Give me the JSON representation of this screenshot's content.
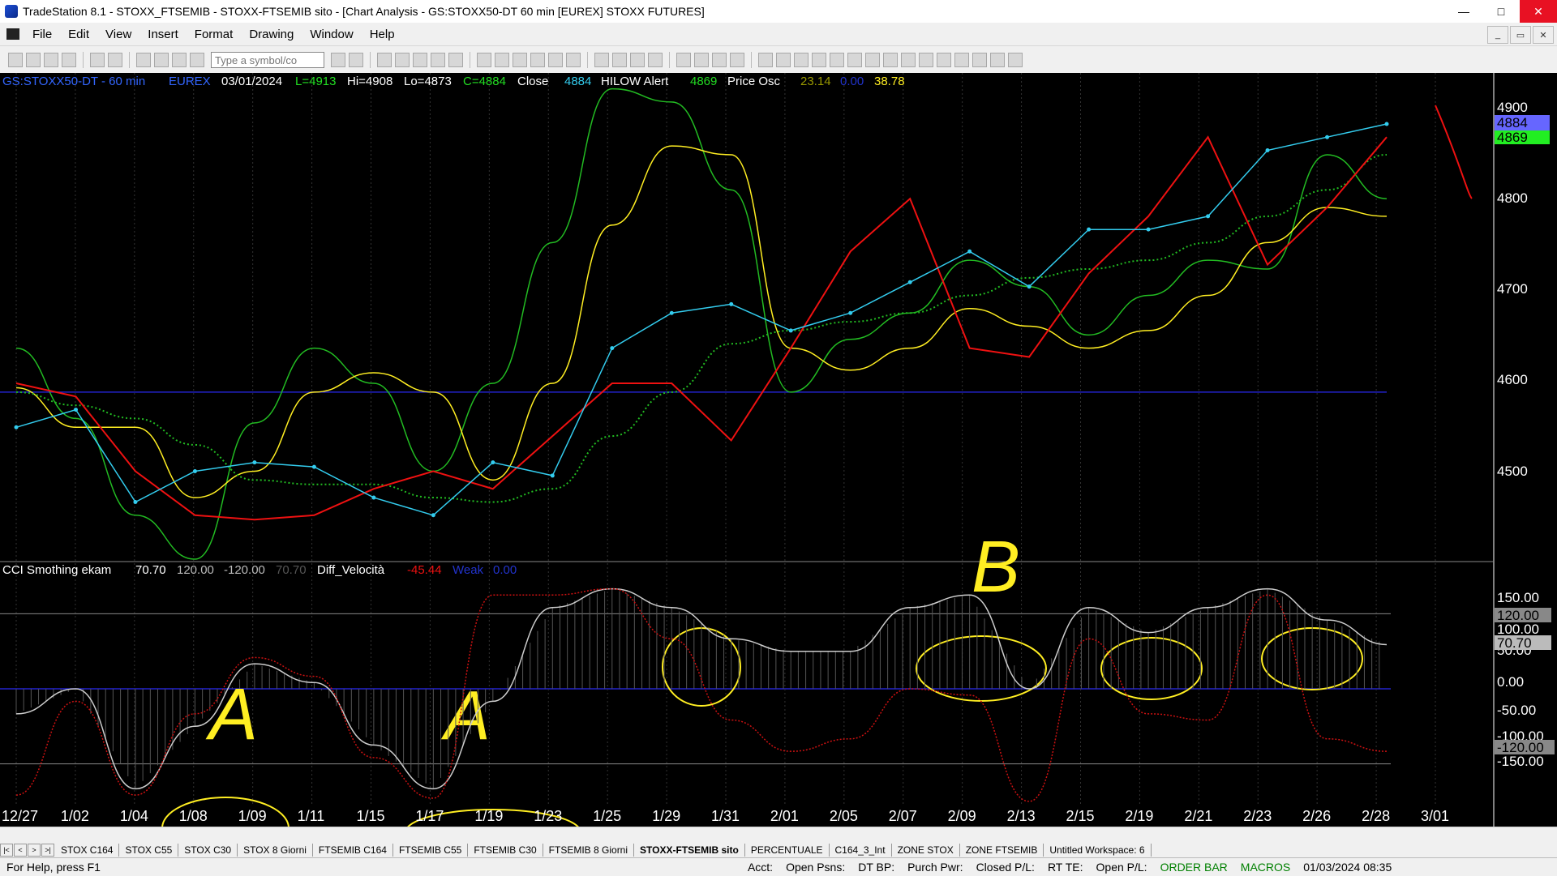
{
  "window": {
    "title": "TradeStation 8.1 - STOXX_FTSEMIB - STOXX-FTSEMIB sito - [Chart Analysis - GS:STOXX50-DT  60 min  [EUREX] STOXX FUTURES]"
  },
  "menu": [
    "File",
    "Edit",
    "View",
    "Insert",
    "Format",
    "Drawing",
    "Window",
    "Help"
  ],
  "toolbar": {
    "symbol_placeholder": "Type a symbol/co"
  },
  "price_header": {
    "symbol": "GS:STOXX50-DT - 60 min",
    "exchange": "EUREX",
    "date": "03/01/2024",
    "last": "L=4913",
    "high": "Hi=4908",
    "low": "Lo=4873",
    "close": "C=4884",
    "close_label": "Close",
    "close_value": "4884",
    "hilow_label": "HILOW Alert",
    "hilow_value": "4869",
    "osc_label": "Price Osc",
    "osc_v1": "23.14",
    "osc_v2": "0.00",
    "osc_v3": "38.78"
  },
  "cci_header": {
    "name": "CCI Smothing ekam",
    "v1": "70.70",
    "v2": "120.00",
    "v3": "-120.00",
    "v4": "70.70",
    "diff_name": "Diff_Velocità",
    "diff_value": "-45.44",
    "weak_label": "Weak",
    "weak_value": "0.00"
  },
  "price_axis": {
    "ticks": [
      "4900",
      "4800",
      "4700",
      "4600",
      "4500"
    ],
    "last_tag": "4884",
    "hilow_tag": "4869"
  },
  "cci_axis": {
    "ticks": [
      "150.00",
      "100.00",
      "50.00",
      "0.00",
      "-50.00",
      "-100.00",
      "-150.00"
    ],
    "tag_120": "120.00",
    "tag_cci": "70.70",
    "tag_m120": "-120.00"
  },
  "time_axis": [
    "12/27",
    "1/02",
    "1/04",
    "1/08",
    "1/09",
    "1/11",
    "1/15",
    "1/17",
    "1/19",
    "1/23",
    "1/25",
    "1/29",
    "1/31",
    "2/01",
    "2/05",
    "2/07",
    "2/09",
    "2/13",
    "2/15",
    "2/19",
    "2/21",
    "2/23",
    "2/26",
    "2/28",
    "3/01"
  ],
  "annotations": {
    "letter_a1": "A",
    "letter_a2": "A",
    "letter_b": "B"
  },
  "tabs": [
    "STOX C164",
    "STOX C55",
    "STOX  C30",
    "STOX  8 Giorni",
    "FTSEMIB C164",
    "FTSEMIB C55",
    "FTSEMIB C30",
    "FTSEMIB  8 Giorni",
    "STOXX-FTSEMIB sito",
    "PERCENTUALE",
    "C164_3_Int",
    "ZONE STOX",
    "ZONE FTSEMIB",
    "Untitled Workspace:  6"
  ],
  "active_tab": "STOXX-FTSEMIB sito",
  "status": {
    "help": "For Help, press F1",
    "acct": "Acct:",
    "open_psns": "Open Psns:",
    "dt_bp": "DT BP:",
    "purch_pwr": "Purch Pwr:",
    "closed_pl": "Closed P/L:",
    "rt_te": "RT TE:",
    "open_pl": "Open P/L:",
    "order_bar": "ORDER BAR",
    "macros": "MACROS",
    "datetime": "01/03/2024 08:35"
  },
  "colors": {
    "price": "#33ccee",
    "green": "#22bb22",
    "yellow": "#ffee22",
    "red": "#ee1111",
    "darkred": "#cc1111",
    "blue": "#2222cc",
    "grid": "#444"
  },
  "chart_data": [
    {
      "type": "line",
      "title": "GS:STOXX50-DT - 60 min",
      "ylim": [
        4400,
        4930
      ],
      "x": [
        "12/27",
        "1/02",
        "1/04",
        "1/08",
        "1/09",
        "1/11",
        "1/15",
        "1/17",
        "1/19",
        "1/23",
        "1/25",
        "1/29",
        "1/31",
        "2/01",
        "2/05",
        "2/07",
        "2/09",
        "2/13",
        "2/15",
        "2/19",
        "2/21",
        "2/23",
        "2/26",
        "2/28"
      ],
      "series": [
        {
          "name": "Close",
          "values": [
            4550,
            4570,
            4465,
            4500,
            4510,
            4505,
            4470,
            4450,
            4510,
            4495,
            4640,
            4680,
            4690,
            4660,
            4680,
            4715,
            4750,
            4710,
            4775,
            4775,
            4790,
            4865,
            4880,
            4895
          ]
        },
        {
          "values": [
            4640,
            4560,
            4450,
            4400,
            4555,
            4640,
            4600,
            4500,
            4600,
            4760,
            4935,
            4920,
            4820,
            4590,
            4650,
            4680,
            4740,
            4710,
            4655,
            4700,
            4740,
            4730,
            4860,
            4810
          ]
        },
        {
          "values": [
            4595,
            4550,
            4550,
            4470,
            4500,
            4590,
            4612,
            4590,
            4490,
            4600,
            4780,
            4870,
            4860,
            4640,
            4615,
            4640,
            4685,
            4665,
            4640,
            4660,
            4700,
            4760,
            4800,
            4790
          ]
        },
        {
          "values": [
            4590,
            4575,
            4560,
            4530,
            4490,
            4485,
            4485,
            4470,
            4465,
            4480,
            4540,
            4590,
            4645,
            4660,
            4670,
            4680,
            4700,
            4720,
            4730,
            4740,
            4760,
            4790,
            4820,
            4860
          ]
        },
        {
          "values": [
            4600,
            4585,
            4500,
            4450,
            4445,
            4450,
            4480,
            4500,
            4480,
            4540,
            4600,
            4600,
            4535,
            4640,
            4750,
            4810,
            4640,
            4630,
            4725,
            4790,
            4880,
            4735,
            4800,
            4880
          ]
        }
      ]
    },
    {
      "type": "area",
      "title": "CCI Smothing ekam",
      "ylim": [
        -175,
        175
      ],
      "x": [
        "12/27",
        "1/02",
        "1/04",
        "1/08",
        "1/09",
        "1/11",
        "1/15",
        "1/17",
        "1/19",
        "1/23",
        "1/25",
        "1/29",
        "1/31",
        "2/01",
        "2/05",
        "2/07",
        "2/09",
        "2/13",
        "2/15",
        "2/19",
        "2/21",
        "2/23",
        "2/26",
        "2/28"
      ],
      "series": [
        {
          "name": "CCI Smothing ekam",
          "values": [
            -40,
            0,
            -160,
            -60,
            40,
            10,
            -90,
            -160,
            -20,
            130,
            160,
            130,
            80,
            60,
            60,
            130,
            150,
            0,
            130,
            90,
            130,
            160,
            110,
            70.7
          ]
        },
        {
          "name": "Diff_Velocità",
          "values": [
            -170,
            -20,
            -170,
            -40,
            50,
            20,
            -110,
            -175,
            150,
            150,
            160,
            80,
            -50,
            -100,
            -80,
            0,
            -10,
            -180,
            80,
            -40,
            -50,
            150,
            -80,
            -100
          ]
        }
      ]
    }
  ]
}
